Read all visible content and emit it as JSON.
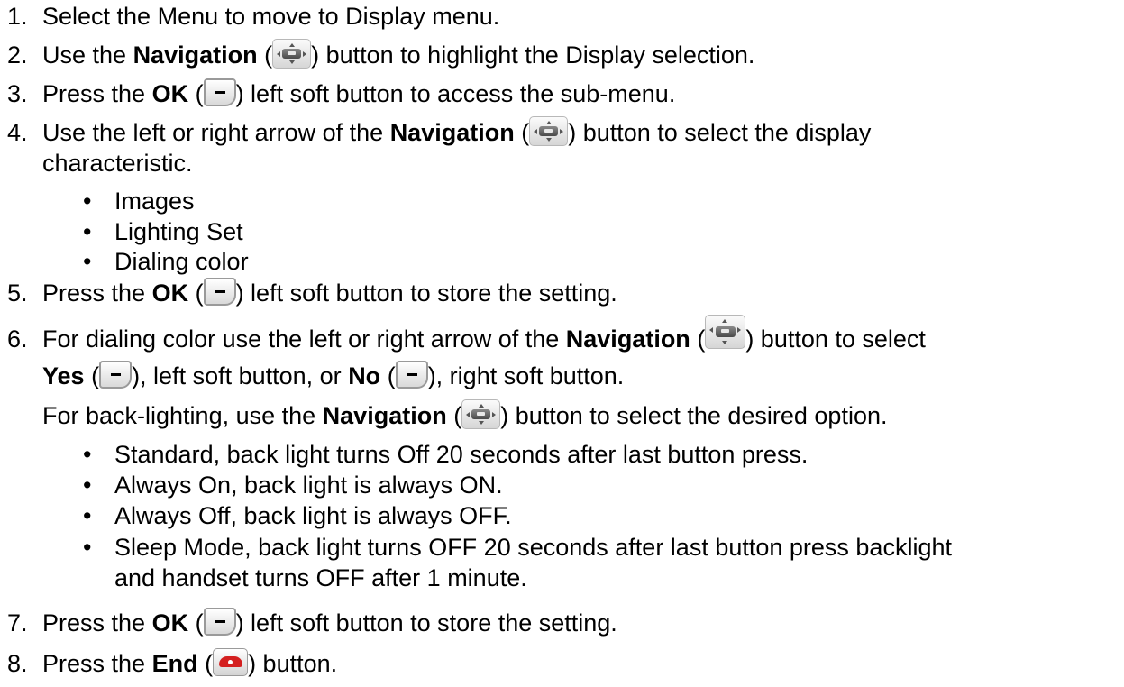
{
  "steps": {
    "s1": {
      "num": "1.",
      "text": "Select the Menu to move to Display menu."
    },
    "s2": {
      "num": "2.",
      "pre": "Use the ",
      "bold": "Navigation",
      "open": " (",
      "post": ") button to highlight the Display selection."
    },
    "s3": {
      "num": "3.",
      "pre": "Press the ",
      "bold": "OK",
      "open": " (",
      "post": ") left soft button to access the sub-menu."
    },
    "s4": {
      "num": "4.",
      "pre": "Use the left or right arrow of the ",
      "bold": "Navigation",
      "open": " (",
      "post": ") button to select the display",
      "cont": "characteristic.",
      "bullets": [
        "Images",
        "Lighting Set",
        "Dialing color"
      ]
    },
    "s5": {
      "num": "5.",
      "pre": "Press the ",
      "bold": "OK",
      "open": " (",
      "post": ") left soft button to store the setting."
    },
    "s6": {
      "num": "6.",
      "pre": "For dialing color use the left or right arrow of the ",
      "bold": "Navigation",
      "open": " (",
      "post": ") button to select",
      "yes": "Yes",
      "yes_open": " (",
      "yes_post": "), left soft button, or ",
      "no": "No",
      "no_open": " (",
      "no_post": "), right soft button.",
      "bl_pre": "For back-lighting, use the ",
      "bl_bold": "Navigation",
      "bl_open": " (",
      "bl_post": ") button to select the desired option.",
      "bullets": [
        "Standard, back light turns Off 20 seconds after last button press.",
        "Always On, back light is always ON.",
        "Always Off, back light is always OFF.",
        "Sleep Mode, back light turns OFF 20 seconds after last button press backlight"
      ],
      "bullet_cont": "and handset turns OFF after 1 minute."
    },
    "s7": {
      "num": "7.",
      "pre": "Press the ",
      "bold": "OK",
      "open": " (",
      "post": ") left soft button to store the setting."
    },
    "s8": {
      "num": "8.",
      "pre": "Press the ",
      "bold": "End",
      "open": " (",
      "post": ") button."
    }
  },
  "bullet_char": "•",
  "icons": {
    "nav": "navigation-button-icon",
    "soft": "soft-button-icon",
    "end": "end-call-icon"
  }
}
